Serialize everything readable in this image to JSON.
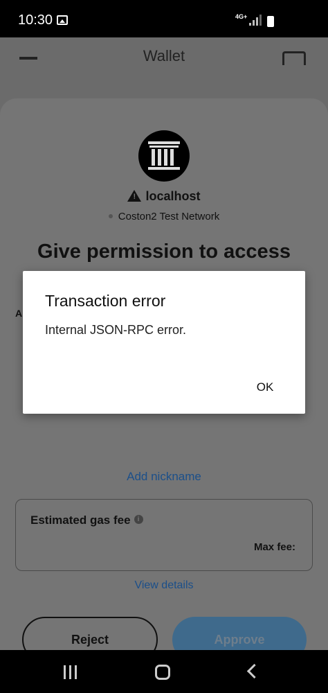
{
  "status_bar": {
    "time": "10:30",
    "network": "4G+",
    "icons": [
      "image-icon",
      "signal-icon",
      "battery-icon"
    ]
  },
  "header": {
    "title": "Wallet",
    "icons": [
      "menu-icon",
      "scan-icon"
    ]
  },
  "permission": {
    "origin": "localhost",
    "network": "Coston2 Test Network",
    "headline": "Give permission to access your testALGO?",
    "clipped_label": "A",
    "add_nickname": "Add nickname",
    "gas": {
      "label": "Estimated gas fee",
      "max_fee_label": "Max fee:"
    },
    "view_details": "View details",
    "reject": "Reject",
    "approve": "Approve"
  },
  "dialog": {
    "title": "Transaction error",
    "message": "Internal JSON-RPC error.",
    "ok": "OK"
  },
  "colors": {
    "link": "#1b4f8a",
    "approve_bg": "#3f6a8c",
    "overlay": "#757575"
  }
}
